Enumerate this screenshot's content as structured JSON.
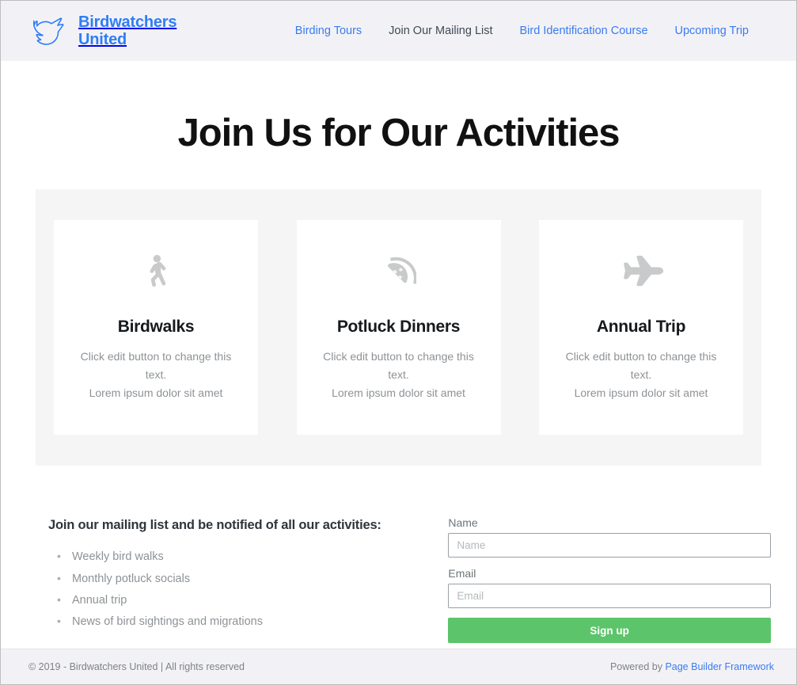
{
  "header": {
    "brand": {
      "logo_icon": "dove-icon",
      "name": "Birdwatchers\nUnited",
      "color": "#2f7df6"
    },
    "nav": [
      {
        "label": "Birding Tours",
        "current": false
      },
      {
        "label": "Join Our Mailing List",
        "current": true
      },
      {
        "label": "Bird Identification Course",
        "current": false
      },
      {
        "label": "Upcoming Trip",
        "current": false
      }
    ]
  },
  "hero": {
    "title": "Join Us for Our Activities"
  },
  "activities": [
    {
      "icon": "walking-person-icon",
      "title": "Birdwalks",
      "line1": "Click edit button to change this text.",
      "line2": "Lorem ipsum dolor sit amet"
    },
    {
      "icon": "pizza-slice-icon",
      "title": "Potluck Dinners",
      "line1": "Click edit button to change this text.",
      "line2": "Lorem ipsum dolor sit amet"
    },
    {
      "icon": "airplane-icon",
      "title": "Annual Trip",
      "line1": "Click edit button to change this text.",
      "line2": "Lorem ipsum dolor sit amet"
    }
  ],
  "signup": {
    "heading": "Join our mailing list and be notified of all our activities:",
    "benefits": [
      "Weekly bird walks",
      "Monthly potluck socials",
      "Annual trip",
      "News of bird sightings and migrations"
    ],
    "form": {
      "name_label": "Name",
      "name_placeholder": "Name",
      "name_value": "",
      "email_label": "Email",
      "email_placeholder": "Email",
      "email_value": "",
      "submit_label": "Sign up",
      "submit_color": "#5cc46a"
    }
  },
  "footer": {
    "copyright": "© 2019 - Birdwatchers United | All rights reserved",
    "powered_by_prefix": "Powered by ",
    "powered_by_link": "Page Builder Framework"
  }
}
